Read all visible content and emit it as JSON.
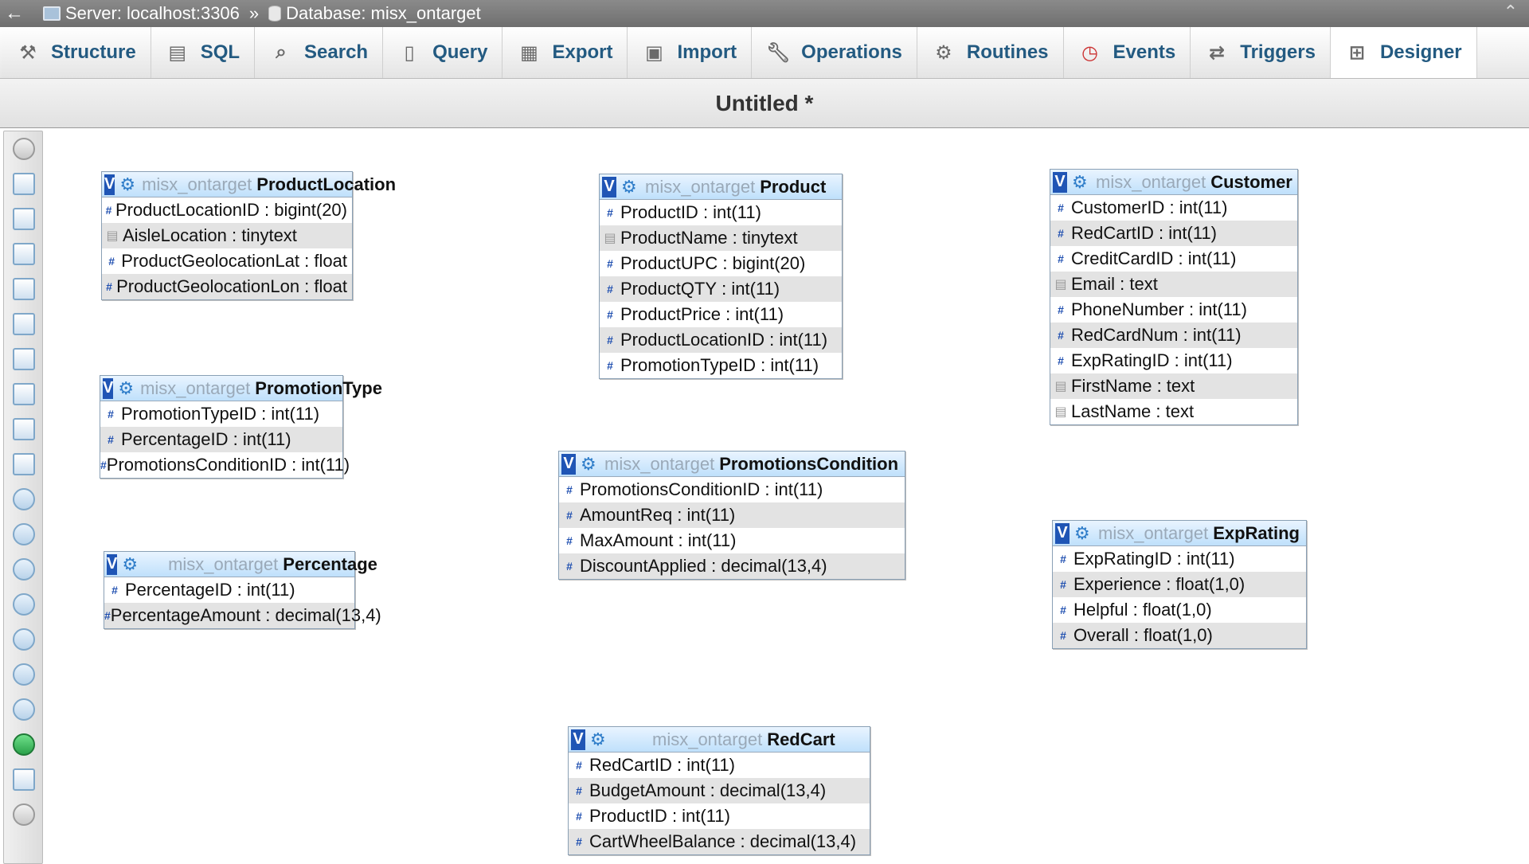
{
  "topbar": {
    "back_icon": "back-arrow",
    "server_label": "Server: localhost:3306",
    "separator": "»",
    "database_label": "Database: misx_ontarget",
    "collapse_icon": "collapse-up"
  },
  "tabs": [
    {
      "label": "Structure",
      "icon": "structure-icon"
    },
    {
      "label": "SQL",
      "icon": "sql-icon"
    },
    {
      "label": "Search",
      "icon": "search-icon"
    },
    {
      "label": "Query",
      "icon": "query-icon"
    },
    {
      "label": "Export",
      "icon": "export-icon"
    },
    {
      "label": "Import",
      "icon": "import-icon"
    },
    {
      "label": "Operations",
      "icon": "wrench-icon"
    },
    {
      "label": "Routines",
      "icon": "routines-icon"
    },
    {
      "label": "Events",
      "icon": "clock-icon"
    },
    {
      "label": "Triggers",
      "icon": "triggers-icon"
    },
    {
      "label": "Designer",
      "icon": "designer-icon",
      "active": true
    }
  ],
  "designer": {
    "title": "Untitled *"
  },
  "tables": [
    {
      "db": "misx_ontarget",
      "name": "ProductLocation",
      "columns": [
        {
          "name": "ProductLocationID",
          "type": "bigint(20)",
          "kind": "numeric"
        },
        {
          "name": "AisleLocation",
          "type": "tinytext",
          "kind": "text"
        },
        {
          "name": "ProductGeolocationLat",
          "type": "float",
          "kind": "numeric"
        },
        {
          "name": "ProductGeolocationLon",
          "type": "float",
          "kind": "numeric"
        }
      ]
    },
    {
      "db": "misx_ontarget",
      "name": "Product",
      "columns": [
        {
          "name": "ProductID",
          "type": "int(11)",
          "kind": "numeric"
        },
        {
          "name": "ProductName",
          "type": "tinytext",
          "kind": "text"
        },
        {
          "name": "ProductUPC",
          "type": "bigint(20)",
          "kind": "numeric"
        },
        {
          "name": "ProductQTY",
          "type": "int(11)",
          "kind": "numeric"
        },
        {
          "name": "ProductPrice",
          "type": "int(11)",
          "kind": "numeric"
        },
        {
          "name": "ProductLocationID",
          "type": "int(11)",
          "kind": "numeric"
        },
        {
          "name": "PromotionTypeID",
          "type": "int(11)",
          "kind": "numeric"
        }
      ]
    },
    {
      "db": "misx_ontarget",
      "name": "Customer",
      "columns": [
        {
          "name": "CustomerID",
          "type": "int(11)",
          "kind": "numeric"
        },
        {
          "name": "RedCartID",
          "type": "int(11)",
          "kind": "numeric"
        },
        {
          "name": "CreditCardID",
          "type": "int(11)",
          "kind": "numeric"
        },
        {
          "name": "Email",
          "type": "text",
          "kind": "text"
        },
        {
          "name": "PhoneNumber",
          "type": "int(11)",
          "kind": "numeric"
        },
        {
          "name": "RedCardNum",
          "type": "int(11)",
          "kind": "numeric"
        },
        {
          "name": "ExpRatingID",
          "type": "int(11)",
          "kind": "numeric"
        },
        {
          "name": "FirstName",
          "type": "text",
          "kind": "text"
        },
        {
          "name": "LastName",
          "type": "text",
          "kind": "text"
        }
      ]
    },
    {
      "db": "misx_ontarget",
      "name": "PromotionType",
      "columns": [
        {
          "name": "PromotionTypeID",
          "type": "int(11)",
          "kind": "numeric"
        },
        {
          "name": "PercentageID",
          "type": "int(11)",
          "kind": "numeric"
        },
        {
          "name": "PromotionsConditionID",
          "type": "int(11)",
          "kind": "numeric"
        }
      ]
    },
    {
      "db": "misx_ontarget",
      "name": "PromotionsCondition",
      "columns": [
        {
          "name": "PromotionsConditionID",
          "type": "int(11)",
          "kind": "numeric"
        },
        {
          "name": "AmountReq",
          "type": "int(11)",
          "kind": "numeric"
        },
        {
          "name": "MaxAmount",
          "type": "int(11)",
          "kind": "numeric"
        },
        {
          "name": "DiscountApplied",
          "type": "decimal(13,4)",
          "kind": "numeric"
        }
      ]
    },
    {
      "db": "misx_ontarget",
      "name": "Percentage",
      "columns": [
        {
          "name": "PercentageID",
          "type": "int(11)",
          "kind": "numeric"
        },
        {
          "name": "PercentageAmount",
          "type": "decimal(13,4)",
          "kind": "numeric"
        }
      ]
    },
    {
      "db": "misx_ontarget",
      "name": "ExpRating",
      "columns": [
        {
          "name": "ExpRatingID",
          "type": "int(11)",
          "kind": "numeric"
        },
        {
          "name": "Experience",
          "type": "float(1,0)",
          "kind": "numeric"
        },
        {
          "name": "Helpful",
          "type": "float(1,0)",
          "kind": "numeric"
        },
        {
          "name": "Overall",
          "type": "float(1,0)",
          "kind": "numeric"
        }
      ]
    },
    {
      "db": "misx_ontarget",
      "name": "RedCart",
      "columns": [
        {
          "name": "RedCartID",
          "type": "int(11)",
          "kind": "numeric"
        },
        {
          "name": "BudgetAmount",
          "type": "decimal(13,4)",
          "kind": "numeric"
        },
        {
          "name": "ProductID",
          "type": "int(11)",
          "kind": "numeric"
        },
        {
          "name": "CartWheelBalance",
          "type": "decimal(13,4)",
          "kind": "numeric"
        }
      ]
    }
  ],
  "left_toolbar": [
    "show-all-icon",
    "fullscreen-icon",
    "add-tables-icon",
    "new-page-icon",
    "edit-page-icon",
    "save-icon",
    "save-as-icon",
    "delete-page-icon",
    "export-schema-icon",
    "create-relation-icon",
    "choose-columns-icon",
    "reload-icon",
    "help-icon",
    "angular-links-icon",
    "snap-grid-icon",
    "small-big-icon",
    "toggle-icon",
    "move-menu-icon",
    "pin-text-icon",
    "hide-icon"
  ]
}
